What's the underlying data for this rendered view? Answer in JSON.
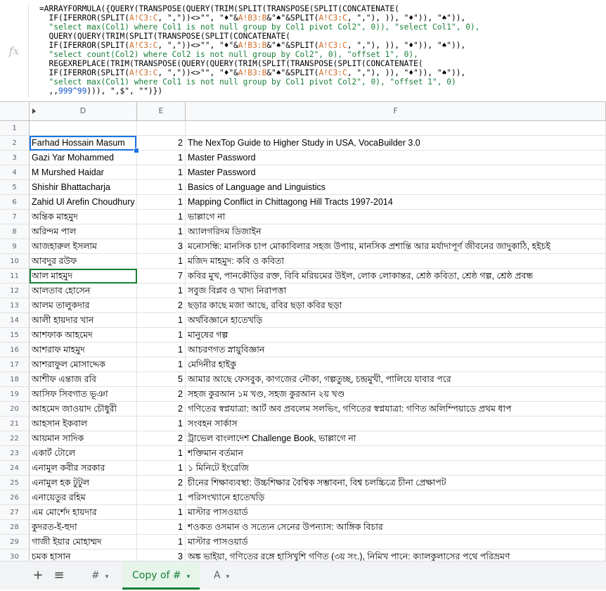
{
  "formula_lines": [
    [
      [
        "=ARRAYFORMULA({QUERY(TRANSPOSE(QUERY(TRIM(SPLIT(TRANSPOSE(SPLIT(CONCATENATE(",
        "fn"
      ]
    ],
    [
      [
        "  IF(IFERROR(SPLIT(",
        "fn"
      ],
      [
        "A!C3:C",
        "ref"
      ],
      [
        ", \",\"))<>\"\", \"♦\"&",
        "fn"
      ],
      [
        "A!B3:B",
        "ref"
      ],
      [
        "&\"♠\"&SPLIT(",
        "fn"
      ],
      [
        "A!C3:C",
        "ref"
      ],
      [
        ", \",\"), )), \"♦\")), \"♠\")),",
        "fn"
      ]
    ],
    [
      [
        "  \"select max(Col1) where Col1 is not null group by Col1 pivot Col2\", 0)), \"select Col1\", 0),",
        "str"
      ]
    ],
    [
      [
        "  QUERY(QUERY(TRIM(SPLIT(TRANSPOSE(SPLIT(CONCATENATE(",
        "fn"
      ]
    ],
    [
      [
        "  IF(IFERROR(SPLIT(",
        "fn"
      ],
      [
        "A!C3:C",
        "ref"
      ],
      [
        ", \",\"))<>\"\", \"♦\"&",
        "fn"
      ],
      [
        "A!B3:B",
        "ref"
      ],
      [
        "&\"♠\"&SPLIT(",
        "fn"
      ],
      [
        "A!C3:C",
        "ref"
      ],
      [
        ", \",\"), )), \"♦\")), \"♠\")),",
        "fn"
      ]
    ],
    [
      [
        "  \"select count(Col2) where Col2 is not null group by Col2\", 0), \"offset 1\", 0),",
        "str"
      ]
    ],
    [
      [
        "  REGEXREPLACE(TRIM(TRANSPOSE(QUERY(QUERY(TRIM(SPLIT(TRANSPOSE(SPLIT(CONCATENATE(",
        "fn"
      ]
    ],
    [
      [
        "  IF(IFERROR(SPLIT(",
        "fn"
      ],
      [
        "A!C3:C",
        "ref"
      ],
      [
        ", \",\"))<>\"\", \"♦\"&",
        "fn"
      ],
      [
        "A!B3:B",
        "ref"
      ],
      [
        "&\"♠\"&SPLIT(",
        "fn"
      ],
      [
        "A!C3:C",
        "ref"
      ],
      [
        ", \",\"), )), \"♦\")), \"♠\")),",
        "fn"
      ]
    ],
    [
      [
        "  \"select max(Col1) where Col1 is not null group by Col1 pivot Col2\", 0), \"offset 1\", 0)",
        "str"
      ]
    ],
    [
      [
        "  ,,",
        "fn"
      ],
      [
        "999^99",
        "num"
      ],
      [
        "))), \",$\", \"\")})",
        "fn"
      ]
    ]
  ],
  "columns": {
    "d": "D",
    "e": "E",
    "f": "F"
  },
  "rows": [
    {
      "n": "1",
      "d": "",
      "e": "",
      "f": ""
    },
    {
      "n": "2",
      "d": "Farhad Hossain Masum",
      "e": "2",
      "f": "The NexTop Guide to Higher Study in USA, VocaBuilder 3.0"
    },
    {
      "n": "3",
      "d": "Gazi Yar Mohammed",
      "e": "1",
      "f": "Master Password"
    },
    {
      "n": "4",
      "d": "M Murshed Haidar",
      "e": "1",
      "f": "Master Password"
    },
    {
      "n": "5",
      "d": "Shishir Bhattacharja",
      "e": "1",
      "f": "Basics of Language and Linguistics"
    },
    {
      "n": "6",
      "d": "Zahid Ul Arefin Choudhury",
      "e": "1",
      "f": "Mapping Conflict in Chittagong Hill Tracts 1997-2014"
    },
    {
      "n": "7",
      "d": "অন্তিক মাহমুদ",
      "e": "1",
      "f": "ভাল্লাগে না"
    },
    {
      "n": "8",
      "d": "অরিন্দম পাল",
      "e": "1",
      "f": "অ্যালগরিদম ডিজাইন"
    },
    {
      "n": "9",
      "d": "আজহারুল ইসলাম",
      "e": "3",
      "f": "মনোসন্ধি: মানসিক চাপ মোকাবিলার সহজ উপায়, মানসিক প্রশান্তি আর মর্যাদাপূর্ণ জীবনের জাদুকাঠি, হইচই"
    },
    {
      "n": "10",
      "d": "আবদুর রউফ",
      "e": "1",
      "f": "মজিদ মাহমুদ: কবি ও কবিতা"
    },
    {
      "n": "11",
      "d": "আল মাহমুদ",
      "e": "7",
      "f": "কবির মুখ, পানকৌড়ির রক্ত, বিবি মরিয়মের উইল, লোক লোকান্তর, শ্রেষ্ঠ কবিতা, শ্রেষ্ঠ গল্প, শ্রেষ্ঠ প্রবন্ধ"
    },
    {
      "n": "12",
      "d": "আলতাব হোসেন",
      "e": "1",
      "f": "সবুজ বিপ্লব ও খাদ্য নিরাপত্তা"
    },
    {
      "n": "13",
      "d": "আলম তালুকদার",
      "e": "2",
      "f": "ছড়ার কাছে মজা আছে, রবির ছড়া কবির ছড়া"
    },
    {
      "n": "14",
      "d": "আলী হায়দার খান",
      "e": "1",
      "f": "অর্থবিজ্ঞানে হাতেখড়ি"
    },
    {
      "n": "15",
      "d": "আশফাক আহমেদ",
      "e": "1",
      "f": "মানুষের গল্প"
    },
    {
      "n": "16",
      "d": "আশরাফ মাহমুদ",
      "e": "1",
      "f": "আচরণগত স্নায়ুবিজ্ঞান"
    },
    {
      "n": "17",
      "d": "আশরাফুল মোসাদ্দেক",
      "e": "1",
      "f": "মেদিনীর হাইকু"
    },
    {
      "n": "18",
      "d": "আশীফ এন্তাজ রবি",
      "e": "5",
      "f": "আমার আছে ফেসবুক, কাগজের নৌকা, গল্পতুচ্ছ, চন্দ্রমুখী, পালিয়ে যাবার পরে"
    },
    {
      "n": "19",
      "d": "আসিফ সিবগাত ভূঞা",
      "e": "2",
      "f": "সহজ কুরআন ১ম খণ্ড, সহজ কুরআন ২য় খণ্ড"
    },
    {
      "n": "20",
      "d": "আহমেদ জাওয়াদ চৌধুরী",
      "e": "2",
      "f": "গণিতের স্বপ্নযাত্রা: আর্ট অব প্রবলেম সলভিং, গণিতের স্বপ্নযাত্রা: গণিত অলিম্পিয়াডে প্রথম ধাপ"
    },
    {
      "n": "21",
      "d": "আহসান ইকবাল",
      "e": "1",
      "f": "সংবহন সার্কাস"
    },
    {
      "n": "22",
      "d": "আয়মান সাদিক",
      "e": "2",
      "f": "ট্রাভেল বাংলাদেশ Challenge Book, ভাল্লাগে না"
    },
    {
      "n": "23",
      "d": "একার্ট টোলে",
      "e": "1",
      "f": "শক্তিমান বর্তমান"
    },
    {
      "n": "24",
      "d": "এনামুল কবীর সরকার",
      "e": "1",
      "f": "১ মিনিটে ইংরেজি"
    },
    {
      "n": "25",
      "d": "এনামুল হক টুটুল",
      "e": "2",
      "f": "চীনের শিক্ষাব্যবস্থা: উচ্চশিক্ষার বৈশ্বিক সম্ভাবনা, বিশ্ব চলচ্চিত্রে চীনা প্রেক্ষাপট"
    },
    {
      "n": "26",
      "d": "এনায়েতুর রহিম",
      "e": "1",
      "f": "পরিসংখ্যানে হাতেখড়ি"
    },
    {
      "n": "27",
      "d": "এম মোর্শেদ হায়দার",
      "e": "1",
      "f": "মাস্টার পাসওয়ার্ড"
    },
    {
      "n": "28",
      "d": "কুদরত-ই-হুদা",
      "e": "1",
      "f": "শওকত ওসমান ও সত্যেন সেনের উপন্যাস: আঙ্গিক বিচার"
    },
    {
      "n": "29",
      "d": "গাজী ইয়ার মোহাম্মদ",
      "e": "1",
      "f": "মাস্টার পাসওয়ার্ড"
    },
    {
      "n": "30",
      "d": "চমক হাসান",
      "e": "3",
      "f": "অঙ্ক ভাইয়া, গণিতের রঙ্গে হাসিখুশি গণিত (৩য় সং.), নিমিখ পানে: ক্যালকুলাসের পথে পরিভ্রমণ"
    }
  ],
  "sheet_tabs": [
    {
      "label": "#",
      "active": false
    },
    {
      "label": "Copy of #",
      "active": true
    },
    {
      "label": "A",
      "active": false
    }
  ],
  "icons": {
    "add": "+",
    "menu": "≡",
    "caret": "▾"
  }
}
